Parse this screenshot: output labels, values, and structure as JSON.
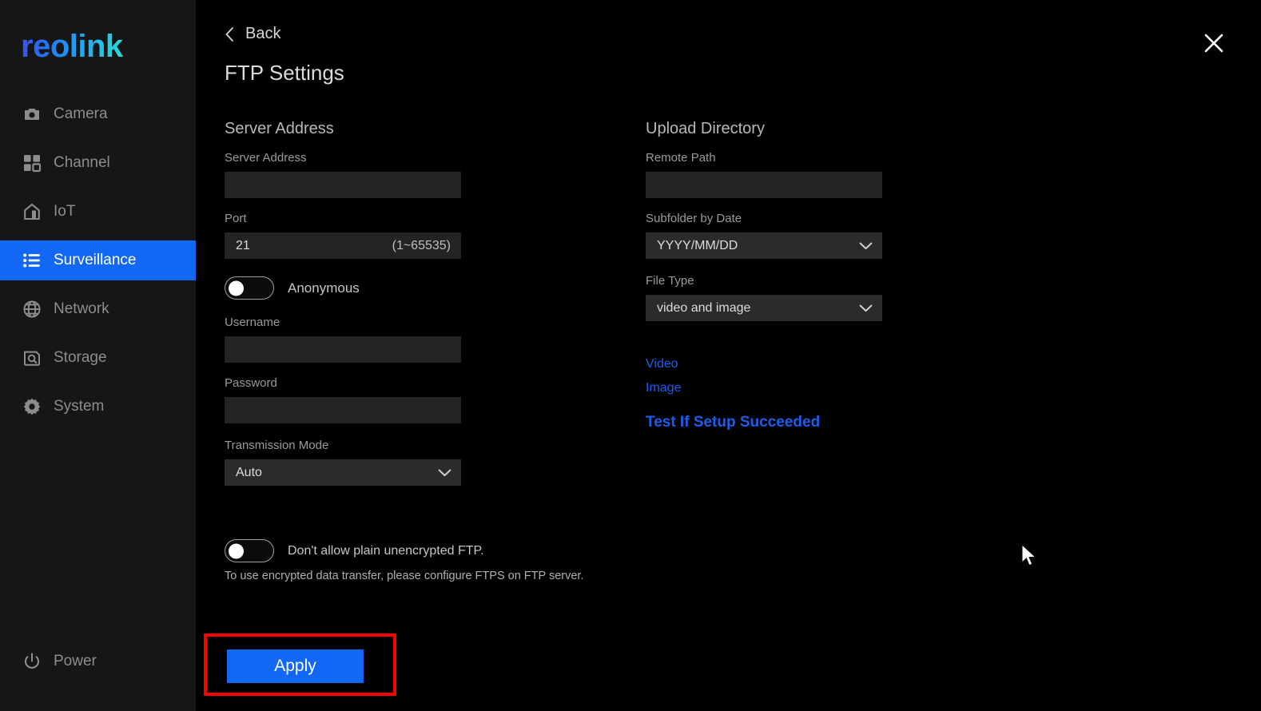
{
  "sidebar": {
    "logo_text": "reolink",
    "items": [
      {
        "label": "Camera",
        "icon": "camera-icon",
        "active": false
      },
      {
        "label": "Channel",
        "icon": "grid-icon",
        "active": false
      },
      {
        "label": "IoT",
        "icon": "home-icon",
        "active": false
      },
      {
        "label": "Surveillance",
        "icon": "list-icon",
        "active": true
      },
      {
        "label": "Network",
        "icon": "globe-icon",
        "active": false
      },
      {
        "label": "Storage",
        "icon": "hard-drive-icon",
        "active": false
      },
      {
        "label": "System",
        "icon": "gear-icon",
        "active": false
      }
    ],
    "power": {
      "label": "Power",
      "icon": "power-icon"
    },
    "active_color": "#1268f5"
  },
  "header": {
    "back_label": "Back",
    "back_icon": "chevron-left-icon",
    "title": "FTP Settings",
    "close_icon": "close-icon"
  },
  "left_column": {
    "section_title": "Server Address",
    "server_address": {
      "label": "Server Address",
      "value": "",
      "placeholder": ""
    },
    "port": {
      "label": "Port",
      "value": "21",
      "hint": "(1~65535)"
    },
    "anonymous": {
      "label": "Anonymous",
      "state": "off"
    },
    "username": {
      "label": "Username",
      "value": "",
      "placeholder": ""
    },
    "password": {
      "label": "Password",
      "value": "",
      "placeholder": ""
    },
    "transmission_mode": {
      "label": "Transmission Mode",
      "selected": "Auto",
      "chevron_icon": "chevron-down-icon"
    }
  },
  "right_column": {
    "section_title": "Upload Directory",
    "remote_path": {
      "label": "Remote Path",
      "value": "",
      "placeholder": ""
    },
    "subfolder_by_date": {
      "label": "Subfolder by Date",
      "selected": "YYYY/MM/DD",
      "chevron_icon": "chevron-down-icon"
    },
    "file_type": {
      "label": "File Type",
      "selected": "video and image",
      "chevron_icon": "chevron-down-icon"
    },
    "links": {
      "video": "Video",
      "image": "Image",
      "test": "Test If Setup Succeeded",
      "color": "#1a5ef0"
    }
  },
  "ftps": {
    "toggle_label": "Don't allow plain unencrypted FTP.",
    "toggle_state": "off",
    "note": "To use encrypted data transfer, please configure FTPS on FTP server."
  },
  "footer": {
    "apply_label": "Apply",
    "apply_color": "#1268f5",
    "highlight_color": "#fe0000"
  }
}
